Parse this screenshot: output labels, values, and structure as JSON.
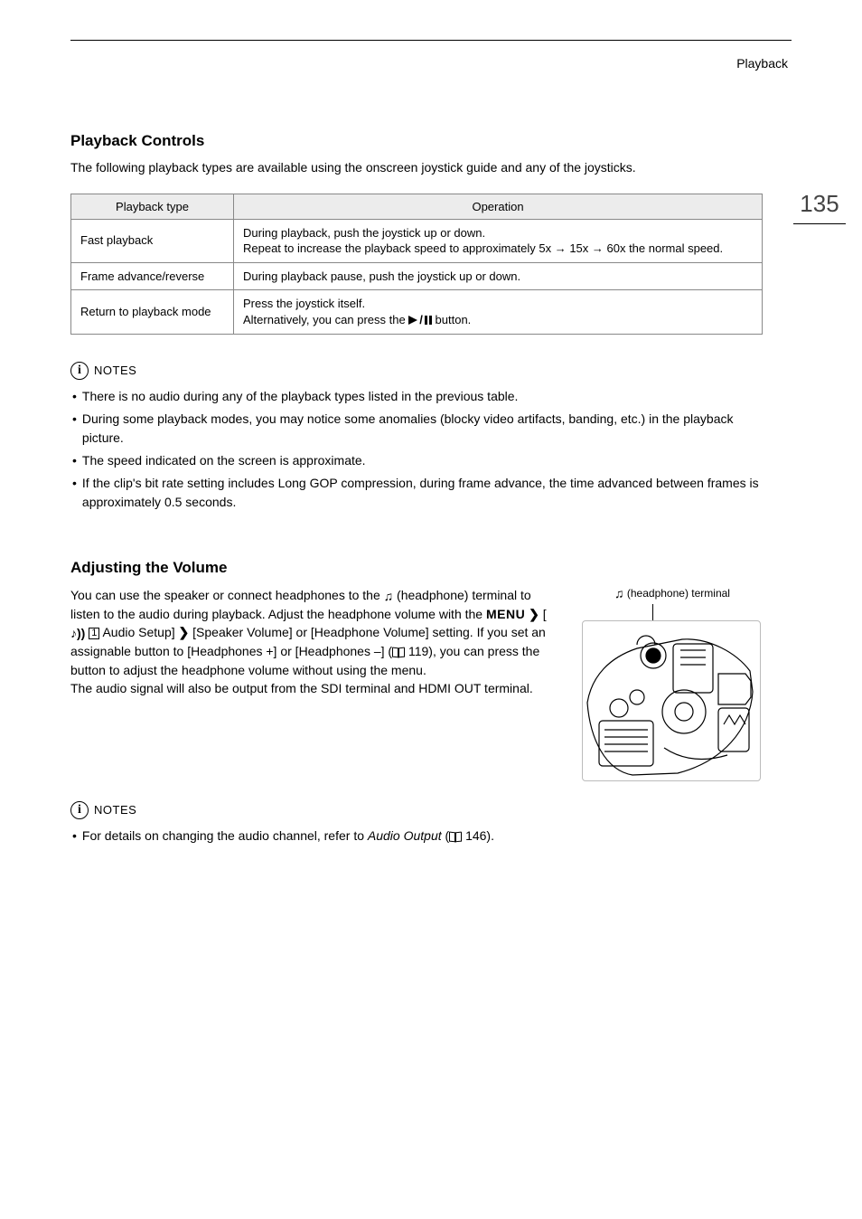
{
  "header": {
    "section": "Playback"
  },
  "page_number": "135",
  "s1": {
    "title": "Playback Controls",
    "intro": "The following playback types are available using the onscreen joystick guide and any of the joysticks.",
    "th1": "Playback type",
    "th2": "Operation",
    "r1c1": "Fast playback",
    "r1c2a": "During playback, push the joystick up or down.",
    "r1c2b": "Repeat to increase the playback speed to approximately 5x → 15x → 60x the normal speed.",
    "r2c1": "Frame advance/reverse",
    "r2c2": "During playback pause, push the joystick up or down.",
    "r3c1": "Return to playback mode",
    "r3c2a": "Press the joystick itself.",
    "r3c2b_pre": "Alternatively, you can press the ",
    "r3c2b_post": " button."
  },
  "notes_label": "NOTES",
  "notes1": {
    "n1": "There is no audio during any of the playback types listed in the previous table.",
    "n2": "During some playback modes, you may notice some anomalies (blocky video artifacts, banding, etc.) in the playback picture.",
    "n3": "The speed indicated on the screen is approximate.",
    "n4": "If the clip's bit rate setting includes Long GOP compression, during frame advance, the time advanced between frames is approximately 0.5 seconds."
  },
  "s2": {
    "title": "Adjusting the Volume",
    "p1a": "You can use the speaker or connect headphones to the ",
    "p1b": " (headphone) terminal to listen to the audio during playback. Adjust the headphone volume with the ",
    "menu": "MENU",
    "p1c": " Audio Setup] ",
    "p1d": " [Speaker Volume] or [Headphone Volume] setting. If you set an assignable button to [Headphones +] or [Headphones –] (",
    "ref1": " 119), you can press the button to adjust the headphone volume without using the menu.",
    "p2": "The audio signal will also be output from the SDI terminal and HDMI OUT terminal.",
    "fig_caption_post": " (headphone) terminal"
  },
  "notes2": {
    "n1_pre": "For details on changing the audio channel, refer to ",
    "n1_italic": "Audio Output",
    "n1_post": " (",
    "n1_ref": " 146)."
  }
}
